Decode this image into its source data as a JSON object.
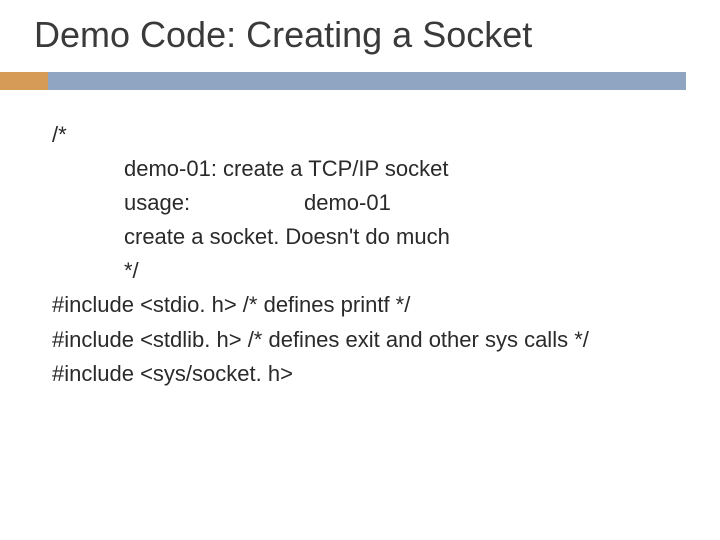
{
  "title": "Demo Code: Creating a Socket",
  "code": {
    "comment_open": "/*",
    "line1": "demo-01: create a TCP/IP socket",
    "usage_label": "usage:",
    "usage_value": "demo-01",
    "line3": "create a socket. Doesn't do much",
    "comment_close": "*/",
    "include1": "#include <stdio. h>   /* defines printf */",
    "include2": "#include <stdlib. h>  /* defines exit and other sys calls */",
    "include3": "#include <sys/socket. h>"
  }
}
